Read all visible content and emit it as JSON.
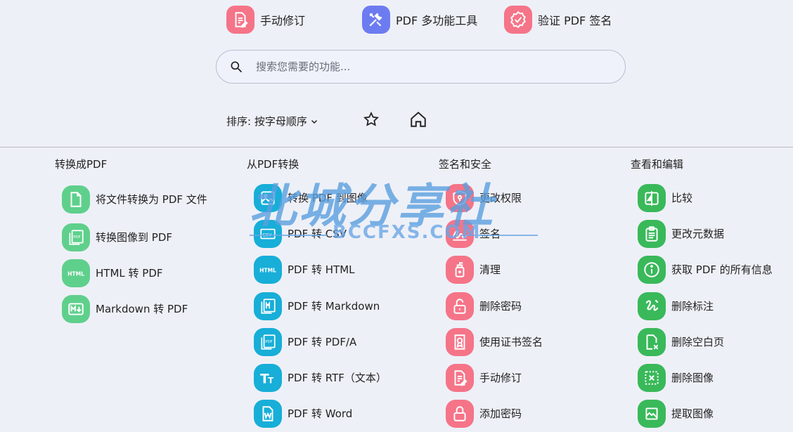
{
  "favorites": [
    {
      "label": "手动修订",
      "icon": "file-edit-icon",
      "color": "#f57488"
    },
    {
      "label": "PDF 多功能工具",
      "icon": "tools-icon",
      "color": "#6c7cf0"
    },
    {
      "label": "验证 PDF 签名",
      "icon": "badge-check-icon",
      "color": "#f57488"
    }
  ],
  "search": {
    "placeholder": "搜索您需要的功能..."
  },
  "sort": {
    "label": "排序: 按字母顺序"
  },
  "columns": [
    {
      "title": "转换成PDF",
      "color": "#5fd08c",
      "items": [
        {
          "label": "将文件转换为 PDF 文件",
          "icon": "file-icon"
        },
        {
          "label": "转换图像到 PDF",
          "icon": "image-pdf-icon"
        },
        {
          "label": "HTML 转 PDF",
          "icon": "html-icon"
        },
        {
          "label": "Markdown 转 PDF",
          "icon": "markdown-icon"
        }
      ]
    },
    {
      "title": "从PDF转换",
      "color": "#17aed8",
      "items": [
        {
          "label": "转换 PDF 到图像",
          "icon": "image-icon"
        },
        {
          "label": "PDF 转 CSV",
          "icon": "csv-icon"
        },
        {
          "label": "PDF 转 HTML",
          "icon": "html-icon"
        },
        {
          "label": "PDF 转 Markdown",
          "icon": "markdown-icon"
        },
        {
          "label": "PDF 转 PDF/A",
          "icon": "pdfa-icon"
        },
        {
          "label": "PDF 转 RTF（文本）",
          "icon": "text-icon"
        },
        {
          "label": "PDF 转 Word",
          "icon": "word-icon"
        }
      ]
    },
    {
      "title": "签名和安全",
      "color": "#f57488",
      "items": [
        {
          "label": "更改权限",
          "icon": "shield-icon"
        },
        {
          "label": "签名",
          "icon": "signature-icon"
        },
        {
          "label": "清理",
          "icon": "spray-icon"
        },
        {
          "label": "删除密码",
          "icon": "unlock-icon"
        },
        {
          "label": "使用证书签名",
          "icon": "certificate-icon"
        },
        {
          "label": "手动修订",
          "icon": "file-edit-icon"
        },
        {
          "label": "添加密码",
          "icon": "lock-icon"
        }
      ]
    },
    {
      "title": "查看和编辑",
      "color": "#39b95a",
      "items": [
        {
          "label": "比较",
          "icon": "compare-icon"
        },
        {
          "label": "更改元数据",
          "icon": "clipboard-icon"
        },
        {
          "label": "获取 PDF 的所有信息",
          "icon": "info-icon"
        },
        {
          "label": "删除标注",
          "icon": "annotation-icon"
        },
        {
          "label": "删除空白页",
          "icon": "file-x-icon"
        },
        {
          "label": "删除图像",
          "icon": "image-remove-icon"
        },
        {
          "label": "提取图像",
          "icon": "image-extract-icon"
        }
      ]
    }
  ],
  "watermark": {
    "text": "北城分享社",
    "sub": "BCCFXS.COM"
  }
}
